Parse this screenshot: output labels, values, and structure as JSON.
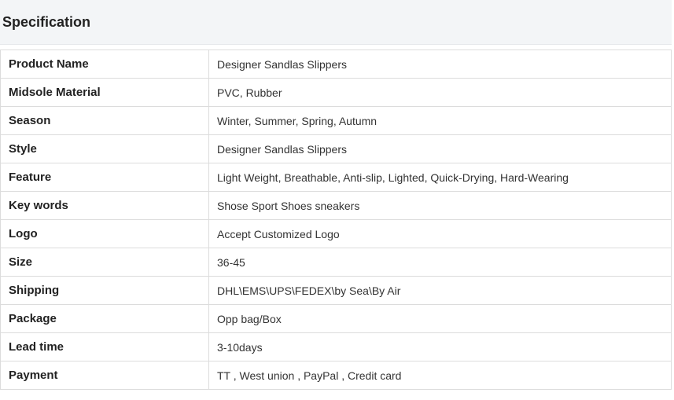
{
  "title": "Specification",
  "rows": [
    {
      "label": "Product Name",
      "value": "Designer Sandlas Slippers"
    },
    {
      "label": "Midsole Material",
      "value": "PVC, Rubber"
    },
    {
      "label": "Season",
      "value": "Winter, Summer, Spring, Autumn"
    },
    {
      "label": "Style",
      "value": "Designer Sandlas Slippers"
    },
    {
      "label": "Feature",
      "value": "Light Weight, Breathable, Anti-slip, Lighted, Quick-Drying, Hard-Wearing"
    },
    {
      "label": "Key words",
      "value": "Shose Sport Shoes sneakers"
    },
    {
      "label": "Logo",
      "value": "Accept Customized Logo"
    },
    {
      "label": "Size",
      "value": "36-45"
    },
    {
      "label": "Shipping",
      "value": "DHL\\EMS\\UPS\\FEDEX\\by Sea\\By Air"
    },
    {
      "label": "Package",
      "value": "Opp bag/Box"
    },
    {
      "label": "Lead time",
      "value": "3-10days"
    },
    {
      "label": "Payment",
      "value": "TT , West union , PayPal , Credit card"
    }
  ]
}
